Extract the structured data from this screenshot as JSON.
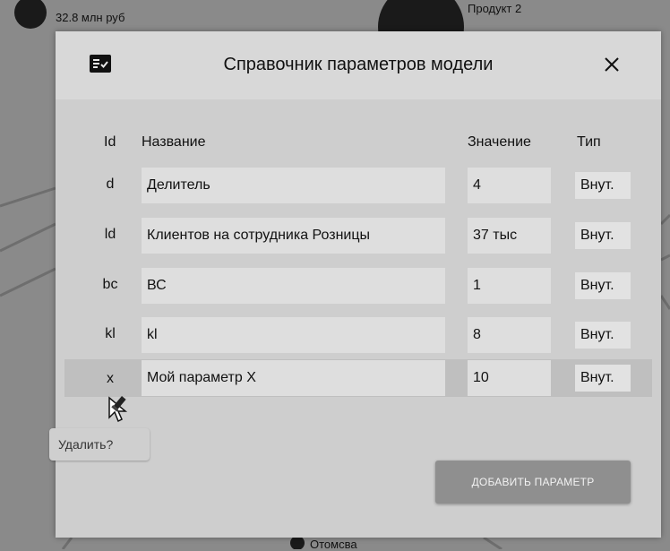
{
  "background": {
    "node_top_left_value": "32.8 млн руб",
    "node_top_right_label": "Продукт 2",
    "node_bottom_label": "Отомсва"
  },
  "modal": {
    "title": "Справочник параметров модели",
    "icon": "checklist-icon",
    "close_icon": "close-icon"
  },
  "table": {
    "headers": {
      "id": "Id",
      "name": "Название",
      "value": "Значение",
      "type": "Тип"
    },
    "rows": [
      {
        "id": "d",
        "name": "Делитель",
        "value": "4",
        "type": "Внут."
      },
      {
        "id": "ld",
        "name": "Клиентов на сотрудника Розницы",
        "value": "37 тыс",
        "type": "Внут."
      },
      {
        "id": "bc",
        "name": "ВС",
        "value": "1",
        "type": "Внут."
      },
      {
        "id": "kl",
        "name": "kl",
        "value": "8",
        "type": "Внут."
      },
      {
        "id": "x",
        "name": "Мой параметр X",
        "value": "10",
        "type": "Внут."
      }
    ]
  },
  "tooltip": {
    "text": "Удалить?"
  },
  "add_button": {
    "label": "ДОБАВИТЬ ПАРАМЕТР"
  },
  "colors": {
    "modal_bg": "#d4d4d4",
    "button_bg": "#8f8f8f",
    "highlight_row": "#bfbfbf"
  }
}
